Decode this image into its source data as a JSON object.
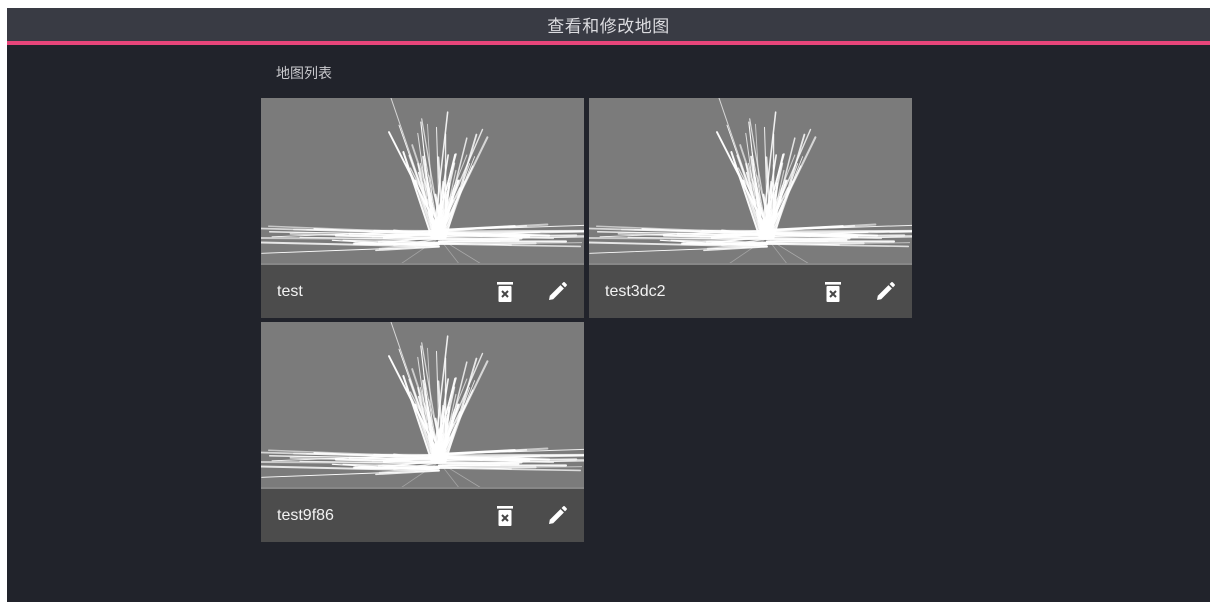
{
  "header": {
    "title": "查看和修改地图"
  },
  "section": {
    "label": "地图列表"
  },
  "maps": [
    {
      "name": "test"
    },
    {
      "name": "test3dc2"
    },
    {
      "name": "test9f86"
    }
  ],
  "colors": {
    "background": "#21232b",
    "header_bg": "#393b44",
    "accent": "#e8457a",
    "card_bg": "#7a7a7a",
    "card_bar": "#464646"
  },
  "icons": {
    "delete": "trash-x-icon",
    "edit": "pencil-icon"
  }
}
